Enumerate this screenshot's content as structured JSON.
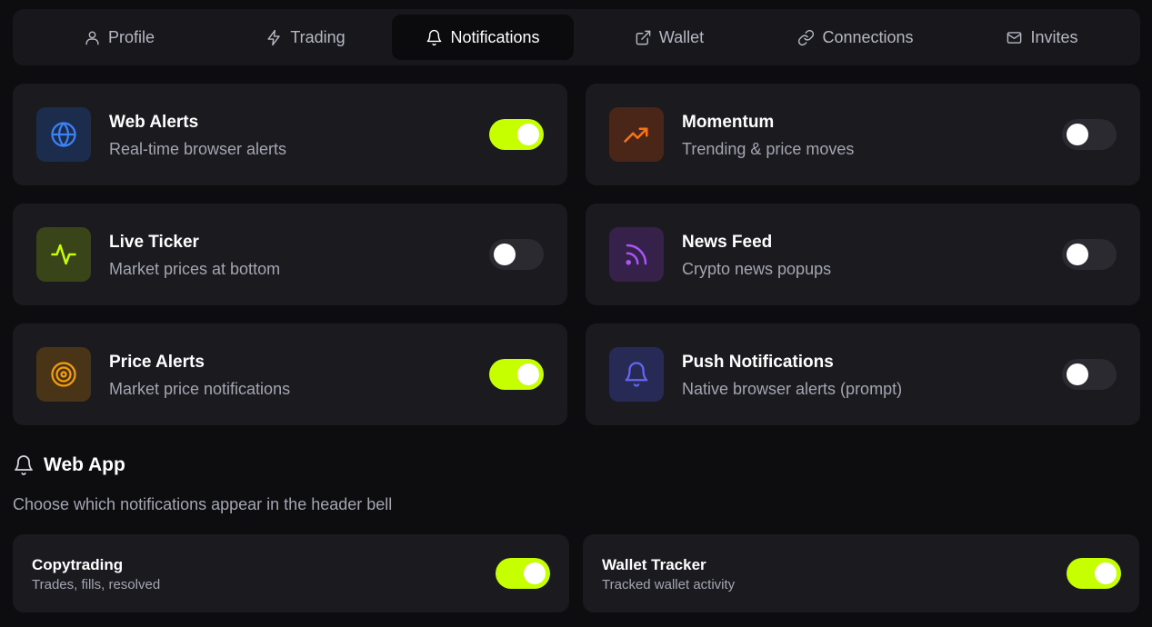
{
  "tabs": [
    {
      "label": "Profile",
      "icon": "user-icon",
      "active": false
    },
    {
      "label": "Trading",
      "icon": "lightning-icon",
      "active": false
    },
    {
      "label": "Notifications",
      "icon": "bell-icon",
      "active": true
    },
    {
      "label": "Wallet",
      "icon": "external-link-icon",
      "active": false
    },
    {
      "label": "Connections",
      "icon": "link-icon",
      "active": false
    },
    {
      "label": "Invites",
      "icon": "mail-icon",
      "active": false
    }
  ],
  "cards": [
    {
      "title": "Web Alerts",
      "subtitle": "Real-time browser alerts",
      "icon": "globe-icon",
      "icon_color": "#3b82f6",
      "icon_bg": "#1c2c4c",
      "enabled": true
    },
    {
      "title": "Momentum",
      "subtitle": "Trending & price moves",
      "icon": "trending-up-icon",
      "icon_color": "#f97316",
      "icon_bg": "#4a2618",
      "enabled": false
    },
    {
      "title": "Live Ticker",
      "subtitle": "Market prices at bottom",
      "icon": "activity-icon",
      "icon_color": "#c6ff00",
      "icon_bg": "#3a4419",
      "enabled": false
    },
    {
      "title": "News Feed",
      "subtitle": "Crypto news popups",
      "icon": "rss-icon",
      "icon_color": "#a855f7",
      "icon_bg": "#36214a",
      "enabled": false
    },
    {
      "title": "Price Alerts",
      "subtitle": "Market price notifications",
      "icon": "target-icon",
      "icon_color": "#f59e0b",
      "icon_bg": "#4a3417",
      "enabled": true
    },
    {
      "title": "Push Notifications",
      "subtitle": "Native browser alerts (prompt)",
      "icon": "bell-icon",
      "icon_color": "#6366f1",
      "icon_bg": "#282a56",
      "enabled": false
    }
  ],
  "web_app": {
    "title": "Web App",
    "description": "Choose which notifications appear in the header bell",
    "items": [
      {
        "title": "Copytrading",
        "subtitle": "Trades, fills, resolved",
        "enabled": true
      },
      {
        "title": "Wallet Tracker",
        "subtitle": "Tracked wallet activity",
        "enabled": true
      }
    ]
  },
  "colors": {
    "accent": "#c6ff00",
    "background": "#0d0d10",
    "card": "#1a1a1f",
    "toggle_off": "#2a2a30"
  }
}
